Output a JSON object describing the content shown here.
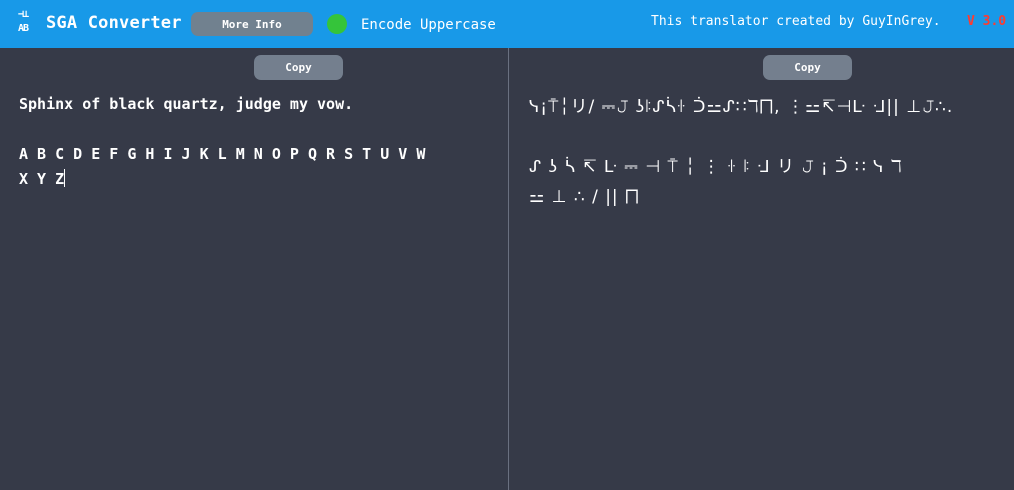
{
  "header": {
    "logo_line1": "⊣⊥",
    "logo_line2": "AB",
    "title": "SGA Converter",
    "more_info_label": "More Info",
    "toggle_label": "Encode Uppercase",
    "credit": "This translator created by GuyInGrey.",
    "version": "V 3.0"
  },
  "left_pane": {
    "copy_label": "Copy",
    "input_line1": "Sphinx of black quartz, judge my vow.",
    "input_line2": "",
    "input_line3": "A B C D E F G H I J K L M N O P Q R S T U V W",
    "input_line4": "X Y Z"
  },
  "right_pane": {
    "copy_label": "Copy",
    "output_text": "ᓭ¡⍑╎リ/ ⎓𝙹 ʖꖎᔑᓵꖌ ᑑ⚍ᔑ∷ℸ⨅, ⋮⚍↸⊣ᒷ ᒲ|| ⊥𝙹∴.\n\nᔑ ʖ ᓵ ↸ ᒷ ⎓ ⊣ ⍑ ╎ ⋮ ꖌ ꖎ ᒲ リ 𝙹 ¡ ᑑ ∷ ᓭ ℸ\n⚍ ⊥ ∴ / || ⨅"
  },
  "colors": {
    "topbar": "#1899e8",
    "background": "#363a48",
    "button": "#747f8e",
    "toggle_on": "#35c43a",
    "version": "#ff3b30"
  }
}
